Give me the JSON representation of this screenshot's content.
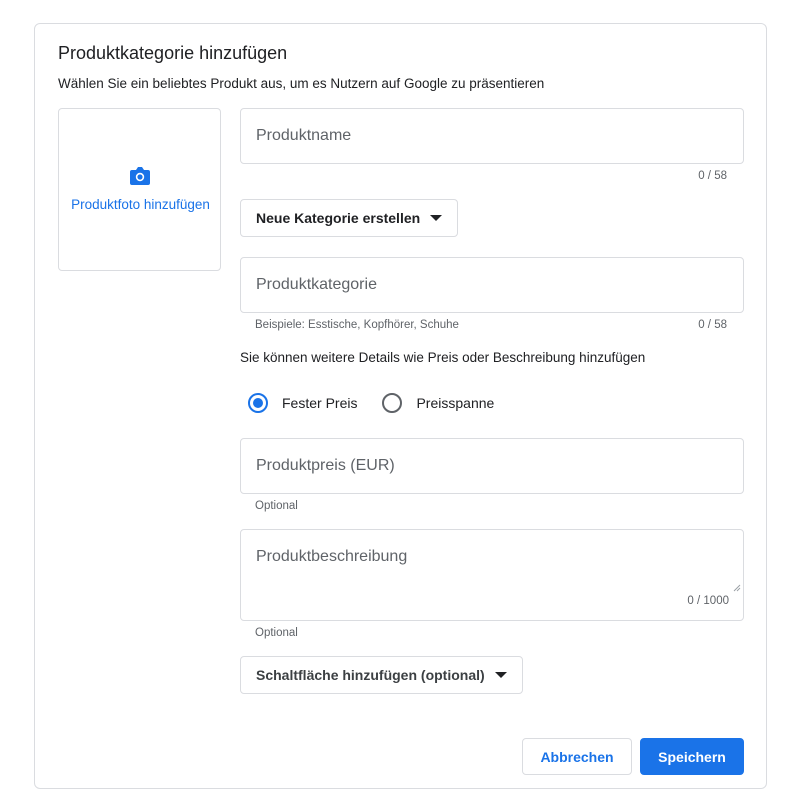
{
  "dialog": {
    "title": "Produktkategorie hinzufügen",
    "subtitle": "Wählen Sie ein beliebtes Produkt aus, um es Nutzern auf Google zu präsentieren",
    "photo": {
      "label": "Produktfoto hinzufügen",
      "icon": "camera-icon"
    },
    "product_name": {
      "placeholder": "Produktname",
      "counter": "0 / 58"
    },
    "create_category_button": {
      "label": "Neue Kategorie erstellen",
      "icon": "caret-down-icon"
    },
    "product_category": {
      "placeholder": "Produktkategorie",
      "hint": "Beispiele: Esstische, Kopfhörer, Schuhe",
      "counter": "0 / 58"
    },
    "details_info": "Sie können weitere Details wie Preis oder Beschreibung hinzufügen",
    "price_type": {
      "options": [
        {
          "label": "Fester Preis",
          "selected": true
        },
        {
          "label": "Preisspanne",
          "selected": false
        }
      ]
    },
    "product_price": {
      "placeholder": "Produktpreis (EUR)",
      "hint": "Optional"
    },
    "product_description": {
      "placeholder": "Produktbeschreibung",
      "counter": "0 / 1000",
      "hint": "Optional"
    },
    "add_button_dropdown": {
      "label": "Schaltfläche hinzufügen (optional)",
      "icon": "caret-down-icon"
    },
    "actions": {
      "cancel_label": "Abbrechen",
      "save_label": "Speichern"
    }
  },
  "colors": {
    "accent": "#1a73e8",
    "border": "#dadce0",
    "text": "#202124",
    "muted": "#5f6368"
  }
}
